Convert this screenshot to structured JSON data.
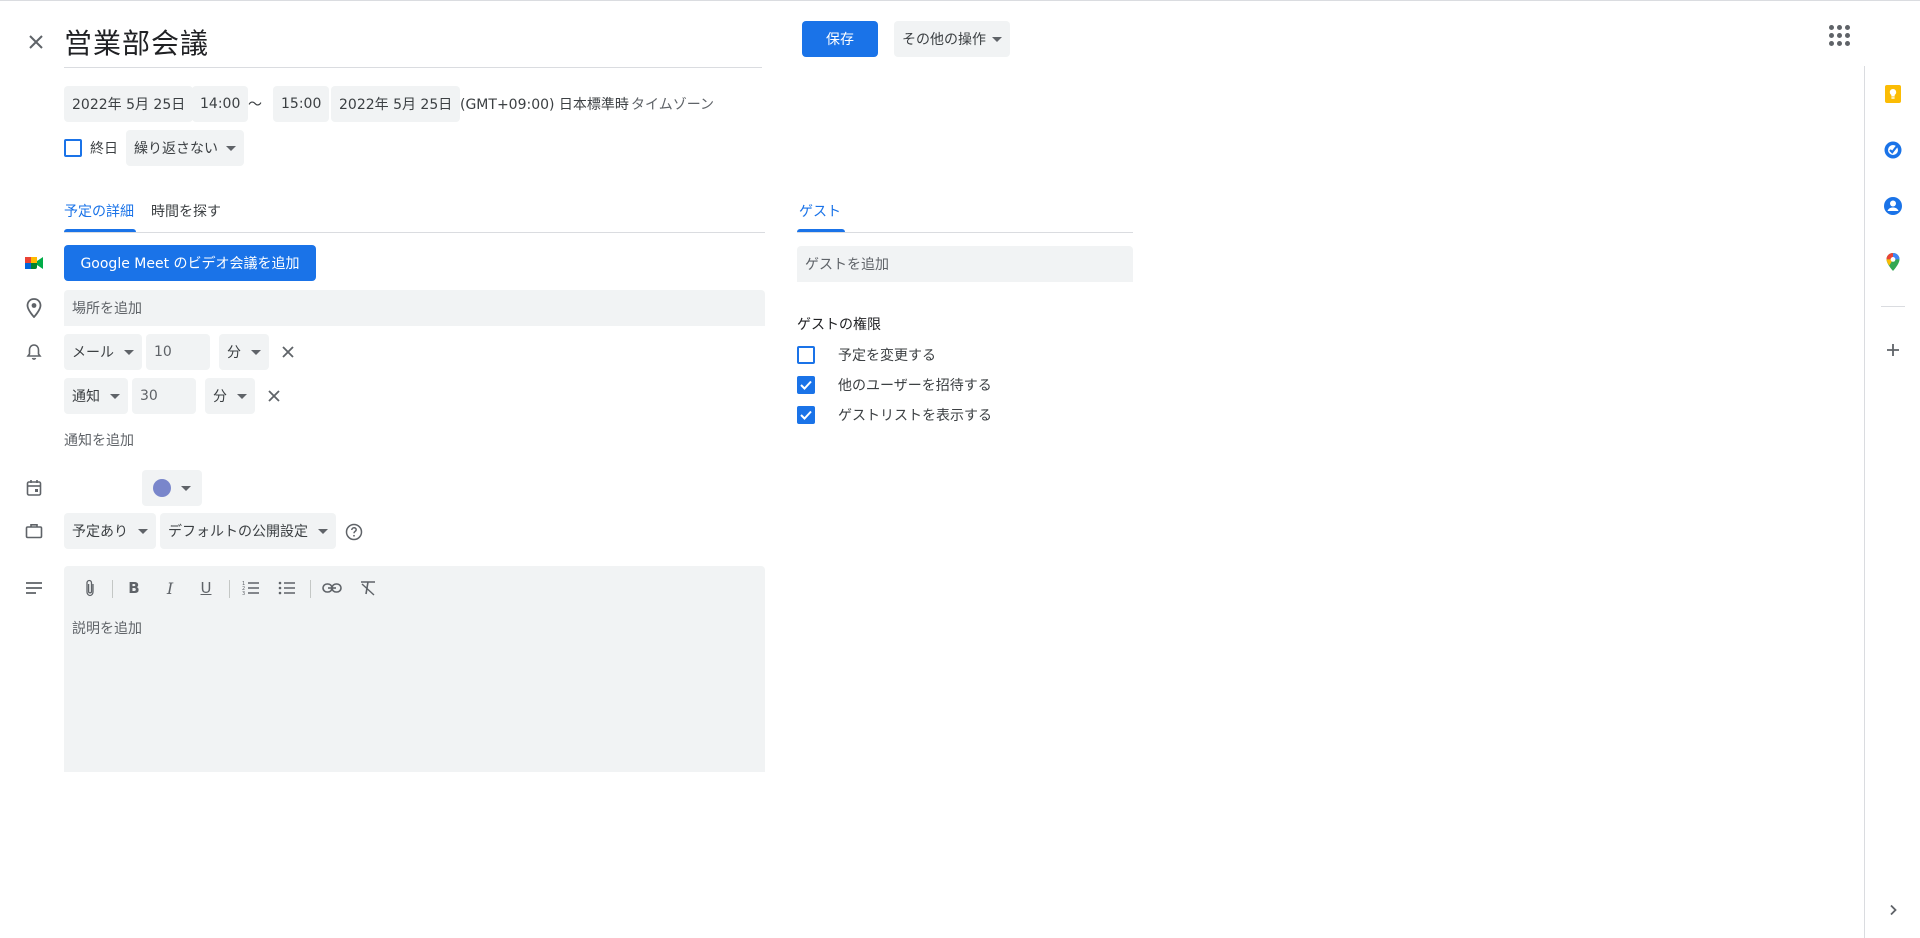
{
  "header": {
    "title": "営業部会議",
    "save_label": "保存",
    "more_actions_label": "その他の操作"
  },
  "datetime": {
    "start_date": "2022年 5月 25日",
    "start_time": "14:00",
    "separator": "〜",
    "end_time": "15:00",
    "end_date": "2022年 5月 25日",
    "timezone_text": "(GMT+09:00) 日本標準時",
    "timezone_link": "タイムゾーン",
    "all_day_label": "終日",
    "repeat_label": "繰り返さない"
  },
  "tabs": {
    "details": "予定の詳細",
    "find_time": "時間を探す",
    "guests": "ゲスト"
  },
  "details": {
    "meet_button": "Google Meet のビデオ会議を追加",
    "location_placeholder": "場所を追加",
    "notifications": [
      {
        "type": "メール",
        "value": "10",
        "unit": "分"
      },
      {
        "type": "通知",
        "value": "30",
        "unit": "分"
      }
    ],
    "add_notification": "通知を追加",
    "event_color": "#7986cb",
    "availability": "予定あり",
    "visibility": "デフォルトの公開設定",
    "description_placeholder": "説明を追加"
  },
  "guests": {
    "add_placeholder": "ゲストを追加",
    "permissions_title": "ゲストの権限",
    "permissions": [
      {
        "label": "予定を変更する",
        "checked": false
      },
      {
        "label": "他のユーザーを招待する",
        "checked": true
      },
      {
        "label": "ゲストリストを表示する",
        "checked": true
      }
    ]
  },
  "colors": {
    "accent": "#1a73e8",
    "field_bg": "#f1f3f4"
  }
}
